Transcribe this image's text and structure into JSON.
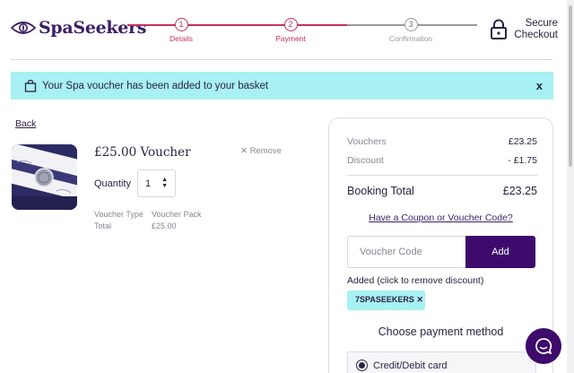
{
  "brand": {
    "logo_prefix": "Spa",
    "logo_suffix": "Seekers",
    "accent": "#c3325f",
    "primary": "#3e0a6b",
    "alert_bg": "#a8f1f2"
  },
  "stepper": {
    "steps": [
      {
        "number": "1",
        "label": "Details",
        "state": "done"
      },
      {
        "number": "2",
        "label": "Payment",
        "state": "active"
      },
      {
        "number": "3",
        "label": "Confirmation",
        "state": "inactive"
      }
    ]
  },
  "secure": {
    "line1": "Secure",
    "line2": "Checkout",
    "icon": "lock-icon"
  },
  "alert": {
    "text": "Your Spa voucher has been added to your basket",
    "close": "x",
    "icon": "shopping-bag-icon"
  },
  "basket": {
    "back_label": "Back",
    "item": {
      "price_title": "£25.00 Voucher",
      "remove_label": "Remove",
      "quantity_label": "Quantity",
      "quantity_value": "1",
      "meta": [
        {
          "key": "Voucher Type",
          "value": "Voucher Pack"
        },
        {
          "key": "Total",
          "value": "£25.00"
        }
      ]
    }
  },
  "summary": {
    "rows": [
      {
        "label": "Vouchers",
        "value": "£23.25"
      },
      {
        "label": "Discount",
        "value": "- £1.75"
      }
    ],
    "total_label": "Booking Total",
    "total_value": "£23.25",
    "coupon_link": "Have a Coupon or Voucher Code?",
    "voucher_placeholder": "Voucher Code",
    "add_label": "Add",
    "added_text": "Added (click to remove discount)",
    "applied_code": "7SPASEEKERS",
    "choose_title": "Choose payment method",
    "payment_option": "Credit/Debit card"
  },
  "chat": {
    "icon": "chat-bubble-icon"
  }
}
